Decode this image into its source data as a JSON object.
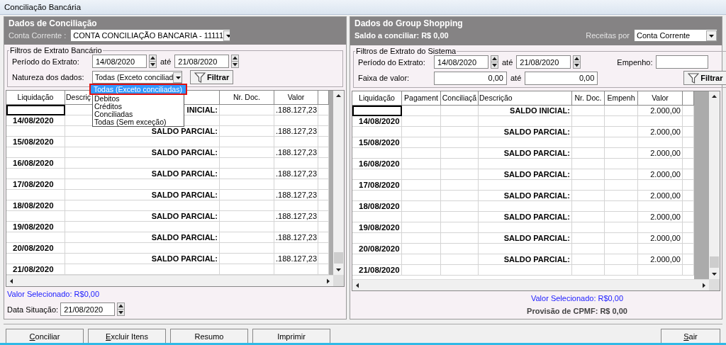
{
  "window": {
    "title": "Conciliação Bancária"
  },
  "left": {
    "title": "Dados de Conciliação",
    "account_label": "Conta Corrente :",
    "account_value": "CONTA CONCILIAÇÃO BANCARIA - 11111",
    "filter": {
      "title": "Filtros de Extrato Bancário",
      "period_label": "Período do Extrato:",
      "from": "14/08/2020",
      "until_label": "até",
      "to": "21/08/2020",
      "nature_label": "Natureza dos dados:",
      "nature_value": "Todas (Exceto conciliad",
      "button": "Filtrar",
      "options": [
        {
          "label": "Todas (Exceto conciliadas)",
          "selected": true
        },
        {
          "label": "Debitos",
          "selected": false
        },
        {
          "label": "Créditos",
          "selected": false
        },
        {
          "label": "Conciliadas",
          "selected": false
        },
        {
          "label": "Todas (Sem exceção)",
          "selected": false
        }
      ]
    },
    "table": {
      "columns": [
        "Liquidação",
        "Descriç",
        "Nr. Doc.",
        "Valor"
      ],
      "rows": [
        {
          "kind": "saldo",
          "selected": true,
          "description": "INICIAL:",
          "value": ".188.127,23"
        },
        {
          "kind": "date",
          "selected": false,
          "date": "14/08/2020"
        },
        {
          "kind": "saldo",
          "selected": false,
          "description": "SALDO PARCIAL:",
          "value": ".188.127,23"
        },
        {
          "kind": "date",
          "selected": false,
          "date": "15/08/2020"
        },
        {
          "kind": "saldo",
          "selected": false,
          "description": "SALDO PARCIAL:",
          "value": ".188.127,23"
        },
        {
          "kind": "date",
          "selected": false,
          "date": "16/08/2020"
        },
        {
          "kind": "saldo",
          "selected": false,
          "description": "SALDO PARCIAL:",
          "value": ".188.127,23"
        },
        {
          "kind": "date",
          "selected": false,
          "date": "17/08/2020"
        },
        {
          "kind": "saldo",
          "selected": false,
          "description": "SALDO PARCIAL:",
          "value": ".188.127,23"
        },
        {
          "kind": "date",
          "selected": false,
          "date": "18/08/2020"
        },
        {
          "kind": "saldo",
          "selected": false,
          "description": "SALDO PARCIAL:",
          "value": ".188.127,23"
        },
        {
          "kind": "date",
          "selected": false,
          "date": "19/08/2020"
        },
        {
          "kind": "saldo",
          "selected": false,
          "description": "SALDO PARCIAL:",
          "value": ".188.127,23"
        },
        {
          "kind": "date",
          "selected": false,
          "date": "20/08/2020"
        },
        {
          "kind": "saldo",
          "selected": false,
          "description": "SALDO PARCIAL:",
          "value": ".188.127,23"
        },
        {
          "kind": "date",
          "selected": false,
          "date": "21/08/2020"
        }
      ]
    },
    "selected_value": "Valor Selecionado: R$0,00",
    "status_date_label": "Data Situação:",
    "status_date": "21/08/2020"
  },
  "right": {
    "title": "Dados do Group Shopping",
    "balance": "Saldo a conciliar: R$ 0,00",
    "revenue_label": "Receitas por",
    "revenue_value": "Conta Corrente",
    "filter": {
      "title": "Filtros de Extrato do Sistema",
      "period_label": "Período do Extrato:",
      "from": "14/08/2020",
      "until_label": "até",
      "to": "21/08/2020",
      "commitment_label": "Empenho:",
      "range_label": "Faixa de valor:",
      "range_from": "0,00",
      "range_until_label": "até",
      "range_to": "0,00",
      "button": "Filtrar"
    },
    "table": {
      "columns": [
        "Liquidação",
        "Pagament",
        "Conciliaçã",
        "Descrição",
        "Nr. Doc.",
        "Empenh",
        "Valor"
      ],
      "rows": [
        {
          "kind": "saldo",
          "selected": true,
          "description": "SALDO INICIAL:",
          "value": "2.000,00"
        },
        {
          "kind": "date",
          "selected": false,
          "date": "14/08/2020"
        },
        {
          "kind": "saldo",
          "selected": false,
          "description": "SALDO PARCIAL:",
          "value": "2.000,00"
        },
        {
          "kind": "date",
          "selected": false,
          "date": "15/08/2020"
        },
        {
          "kind": "saldo",
          "selected": false,
          "description": "SALDO PARCIAL:",
          "value": "2.000,00"
        },
        {
          "kind": "date",
          "selected": false,
          "date": "16/08/2020"
        },
        {
          "kind": "saldo",
          "selected": false,
          "description": "SALDO PARCIAL:",
          "value": "2.000,00"
        },
        {
          "kind": "date",
          "selected": false,
          "date": "17/08/2020"
        },
        {
          "kind": "saldo",
          "selected": false,
          "description": "SALDO PARCIAL:",
          "value": "2.000,00"
        },
        {
          "kind": "date",
          "selected": false,
          "date": "18/08/2020"
        },
        {
          "kind": "saldo",
          "selected": false,
          "description": "SALDO PARCIAL:",
          "value": "2.000,00"
        },
        {
          "kind": "date",
          "selected": false,
          "date": "19/08/2020"
        },
        {
          "kind": "saldo",
          "selected": false,
          "description": "SALDO PARCIAL:",
          "value": "2.000,00"
        },
        {
          "kind": "date",
          "selected": false,
          "date": "20/08/2020"
        },
        {
          "kind": "saldo",
          "selected": false,
          "description": "SALDO PARCIAL:",
          "value": "2.000,00"
        },
        {
          "kind": "date",
          "selected": false,
          "date": "21/08/2020"
        }
      ]
    },
    "selected_value": "Valor Selecionado: R$0,00",
    "cpmf": "Provisão de CPMF:  R$ 0,00"
  },
  "buttons": [
    {
      "label": "Conciliar",
      "underlined_first": true
    },
    {
      "label": "Excluir Itens",
      "underlined_first": true
    },
    {
      "label": "Resumo",
      "underlined_first": false
    },
    {
      "label": "Imprimir",
      "underlined_first": false
    },
    {
      "label": "Sair",
      "underlined_first": true
    }
  ]
}
